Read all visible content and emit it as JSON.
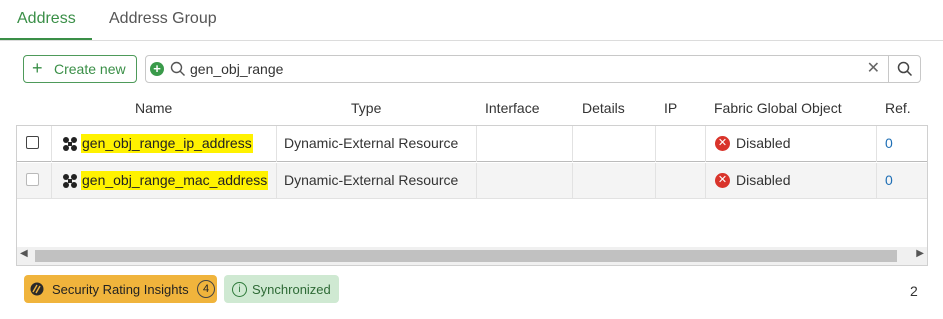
{
  "tabs": [
    {
      "label": "Address",
      "active": true
    },
    {
      "label": "Address Group",
      "active": false
    }
  ],
  "toolbar": {
    "create_label": "Create new",
    "search_value": "gen_obj_range"
  },
  "columns": [
    "Name",
    "Type",
    "Interface",
    "Details",
    "IP",
    "Fabric Global Object",
    "Ref."
  ],
  "rows": [
    {
      "name": "gen_obj_range_ip_address",
      "type": "Dynamic-External Resource",
      "interface": "",
      "details": "",
      "ip": "",
      "fabric": "Disabled",
      "ref": "0"
    },
    {
      "name": "gen_obj_range_mac_address",
      "type": "Dynamic-External Resource",
      "interface": "",
      "details": "",
      "ip": "",
      "fabric": "Disabled",
      "ref": "0"
    }
  ],
  "footer": {
    "security_label": "Security Rating Insights",
    "security_count": "4",
    "sync_label": "Synchronized",
    "total": "2"
  },
  "colors": {
    "accent": "#3a8f47",
    "highlight": "#fff200",
    "disabled": "#d9342b",
    "security": "#f0b43c",
    "sync_bg": "#cfe9d2"
  }
}
